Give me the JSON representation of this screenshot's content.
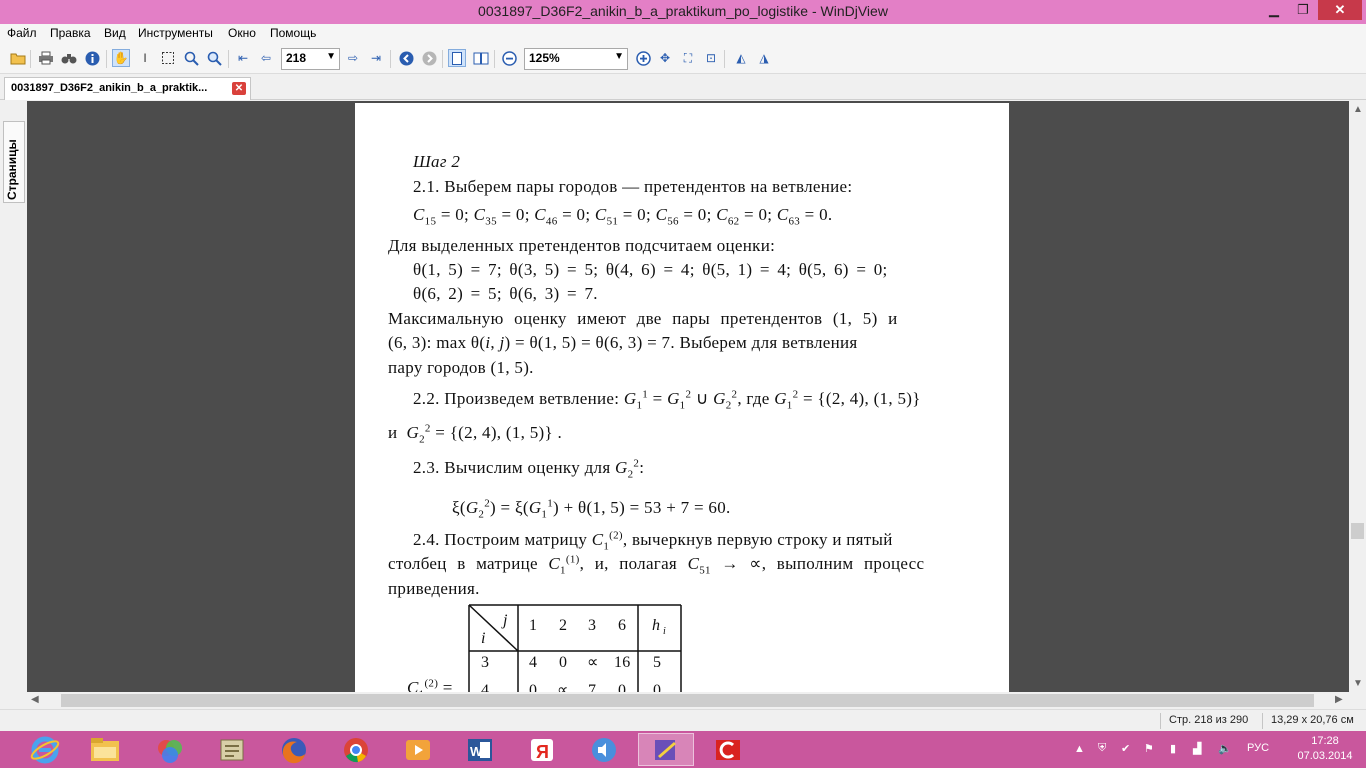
{
  "window": {
    "title": "0031897_D36F2_anikin_b_a_praktikum_po_logistike - WinDjView"
  },
  "menu": [
    "Файл",
    "Правка",
    "Вид",
    "Инструменты",
    "Окно",
    "Помощь"
  ],
  "toolbar": {
    "page_value": "218",
    "zoom_value": "125%"
  },
  "tab": {
    "label": "0031897_D36F2_anikin_b_a_praktik..."
  },
  "sidebar": {
    "tab_label": "Страницы"
  },
  "document": {
    "step": "Шаг 2",
    "p21": "2.1. Выберем пары городов — претендентов на ветвление:",
    "c_list": [
      {
        "sym": "C",
        "sub": "15",
        "val": "= 0;"
      },
      {
        "sym": "C",
        "sub": "35",
        "val": "= 0;"
      },
      {
        "sym": "C",
        "sub": "46",
        "val": "= 0;"
      },
      {
        "sym": "C",
        "sub": "51",
        "val": "= 0;"
      },
      {
        "sym": "C",
        "sub": "56",
        "val": "= 0;"
      },
      {
        "sym": "C",
        "sub": "62",
        "val": "= 0;"
      },
      {
        "sym": "C",
        "sub": "63",
        "val": "= 0."
      }
    ],
    "estimates_intro": "Для выделенных претендентов подсчитаем оценки:",
    "theta_line1": "θ(1, 5) = 7; θ(3, 5) = 5; θ(4, 6) = 4; θ(5, 1) = 4; θ(5, 6) = 0;",
    "theta_line2": "θ(6, 2) = 5; θ(6, 3) = 7.",
    "max_line1": "Максимальную оценку имеют две пары претендентов (1, 5) и",
    "max_line2_a": "(6, 3): max θ(",
    "max_line2_i": "i",
    "max_line2_b": ", ",
    "max_line2_j": "j",
    "max_line2_c": ") = θ(1, 5) = θ(6, 3) = 7. Выберем для ветвления",
    "max_line3": "пару городов (1, 5).",
    "p22": "2.2. Произведем ветвление:",
    "p22_where": ", где",
    "g_set1": "= {(2, 4), (1, 5)}",
    "p22_and": "и",
    "g_set2": "= {(2, 4), (1, 5)} .",
    "p23": "2.3. Вычислим оценку для",
    "xi_formula_tail": "+ θ(1, 5) = 53 + 7 = 60.",
    "p24_line1_a": "2.4. Построим матрицу",
    "p24_line1_b": ", вычеркнув первую строку и пятый",
    "p24_line2_a": "столбец в матрице",
    "p24_line2_b": ", и, полагая",
    "p24_line2_c": "→ ∝, выполним процесс",
    "p24_line3": "приведения.",
    "matrix": {
      "corner_j": "j",
      "corner_i": "i",
      "columns": [
        "1",
        "2",
        "3",
        "6"
      ],
      "h_label": "h",
      "h_sub": "i",
      "rows": [
        {
          "i": "3",
          "cells": [
            "4",
            "0",
            "∝",
            "16"
          ],
          "h": "5"
        },
        {
          "i": "4",
          "cells": [
            "0",
            "∝",
            "7",
            "0"
          ],
          "h": "0"
        }
      ],
      "label_sub": "1",
      "label_sup": "(2)"
    }
  },
  "status": {
    "page_info": "Стр. 218 из 290",
    "size_info": "13,29 x 20,76 см"
  },
  "tray": {
    "lang": "РУС",
    "time": "17:28",
    "date": "07.03.2014"
  },
  "colors": {
    "titlebar": "#e37fc6",
    "taskbar": "#c9579d",
    "close": "#c7394a",
    "viewport": "#4c4c4c"
  }
}
